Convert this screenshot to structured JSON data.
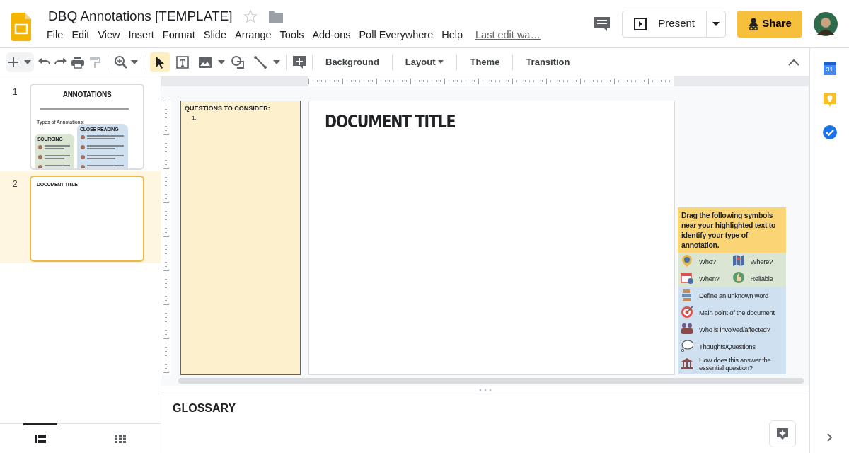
{
  "doc": {
    "title": "DBQ Annotations [TEMPLATE]",
    "starred": false,
    "last_edit": "Last edit wa…"
  },
  "menu": [
    "File",
    "Edit",
    "View",
    "Insert",
    "Format",
    "Slide",
    "Arrange",
    "Tools",
    "Add-ons",
    "Poll Everywhere",
    "Help"
  ],
  "header": {
    "present": "Present",
    "share": "Share"
  },
  "tools": [
    {
      "kind": "select",
      "selected": true
    },
    {
      "kind": "textbox",
      "selected": false
    },
    {
      "kind": "image",
      "selected": false
    },
    {
      "kind": "shape",
      "selected": false
    },
    {
      "kind": "line",
      "selected": false
    }
  ],
  "toolbar_buttons": [
    {
      "label": "Background",
      "menu": false
    },
    {
      "label": "Layout",
      "menu": true
    },
    {
      "label": "Theme",
      "menu": false
    },
    {
      "label": "Transition",
      "menu": false
    }
  ],
  "filmstrip": [
    {
      "number": "1",
      "selected": false,
      "kind": "annotations",
      "title": "ANNOTATIONS",
      "subtitle": "Types of Annotations:",
      "groups": [
        "SOURCING",
        "CLOSE READING"
      ]
    },
    {
      "number": "2",
      "selected": true,
      "kind": "document",
      "title": "DOCUMENT TITLE"
    }
  ],
  "slide": {
    "questions_heading": "QUESTIONS TO CONSIDER:",
    "questions": [
      "1."
    ],
    "title": "DOCUMENT TITLE"
  },
  "legend": {
    "instruction": "Drag the following symbols near your highlighted text to identify your type of annotation.",
    "sourcing": [
      {
        "label": "Who?",
        "kind": "pin"
      },
      {
        "label": "Where?",
        "kind": "map"
      },
      {
        "label": "When?",
        "kind": "calendar"
      },
      {
        "label": "Reliable",
        "kind": "thumb"
      }
    ],
    "close_reading": [
      {
        "label": "Define an unknown word",
        "kind": "books"
      },
      {
        "label": "Main point of the document",
        "kind": "target"
      },
      {
        "label": "Who is involved/affected?",
        "kind": "people"
      },
      {
        "label": "Thoughts/Questions",
        "kind": "bubble"
      },
      {
        "label": "How does this answer the essential question?",
        "kind": "building"
      }
    ]
  },
  "notes": {
    "text": "GLOSSARY"
  },
  "view_tabs": [
    {
      "kind": "filmstrip",
      "selected": true
    },
    {
      "kind": "grid",
      "selected": false
    }
  ],
  "side_panel": {
    "calendar_day": "31"
  }
}
